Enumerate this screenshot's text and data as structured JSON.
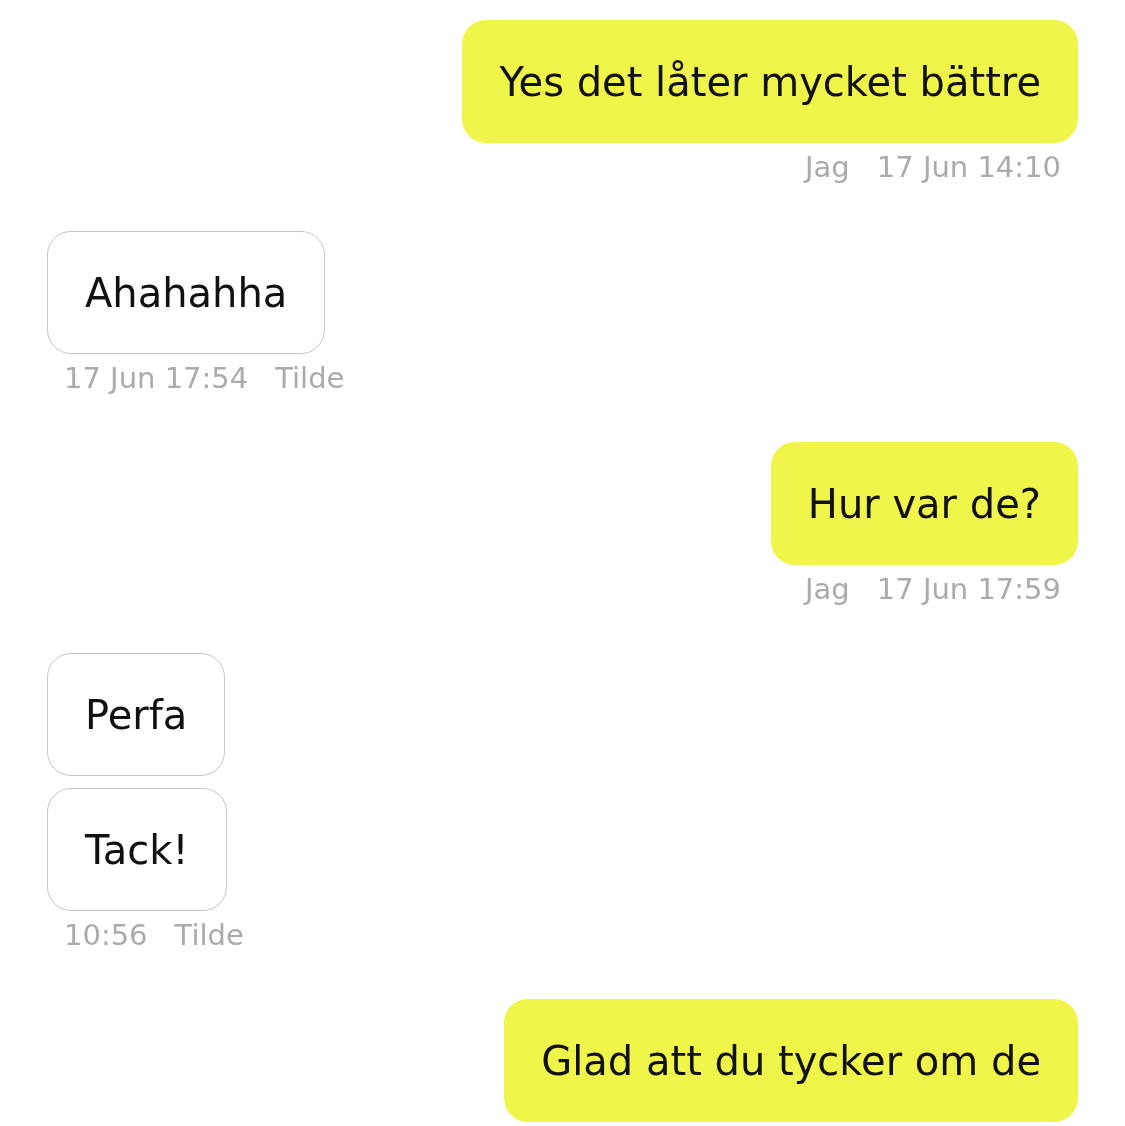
{
  "conversation": {
    "message_groups": [
      {
        "kind": "outgoing",
        "bubbles": [
          "Yes det låter mycket bättre"
        ],
        "sender": "Jag",
        "time": "17 Jun 14:10"
      },
      {
        "kind": "incoming",
        "bubbles": [
          "Ahahahha"
        ],
        "time": "17 Jun 17:54",
        "sender": "Tilde"
      },
      {
        "kind": "outgoing",
        "bubbles": [
          "Hur var de?"
        ],
        "sender": "Jag",
        "time": "17 Jun 17:59"
      },
      {
        "kind": "incoming",
        "bubbles": [
          "Perfa",
          "Tack!"
        ],
        "time": "10:56",
        "sender": "Tilde"
      },
      {
        "kind": "outgoing",
        "bubbles": [
          "Glad att du tycker om de"
        ]
      }
    ]
  }
}
